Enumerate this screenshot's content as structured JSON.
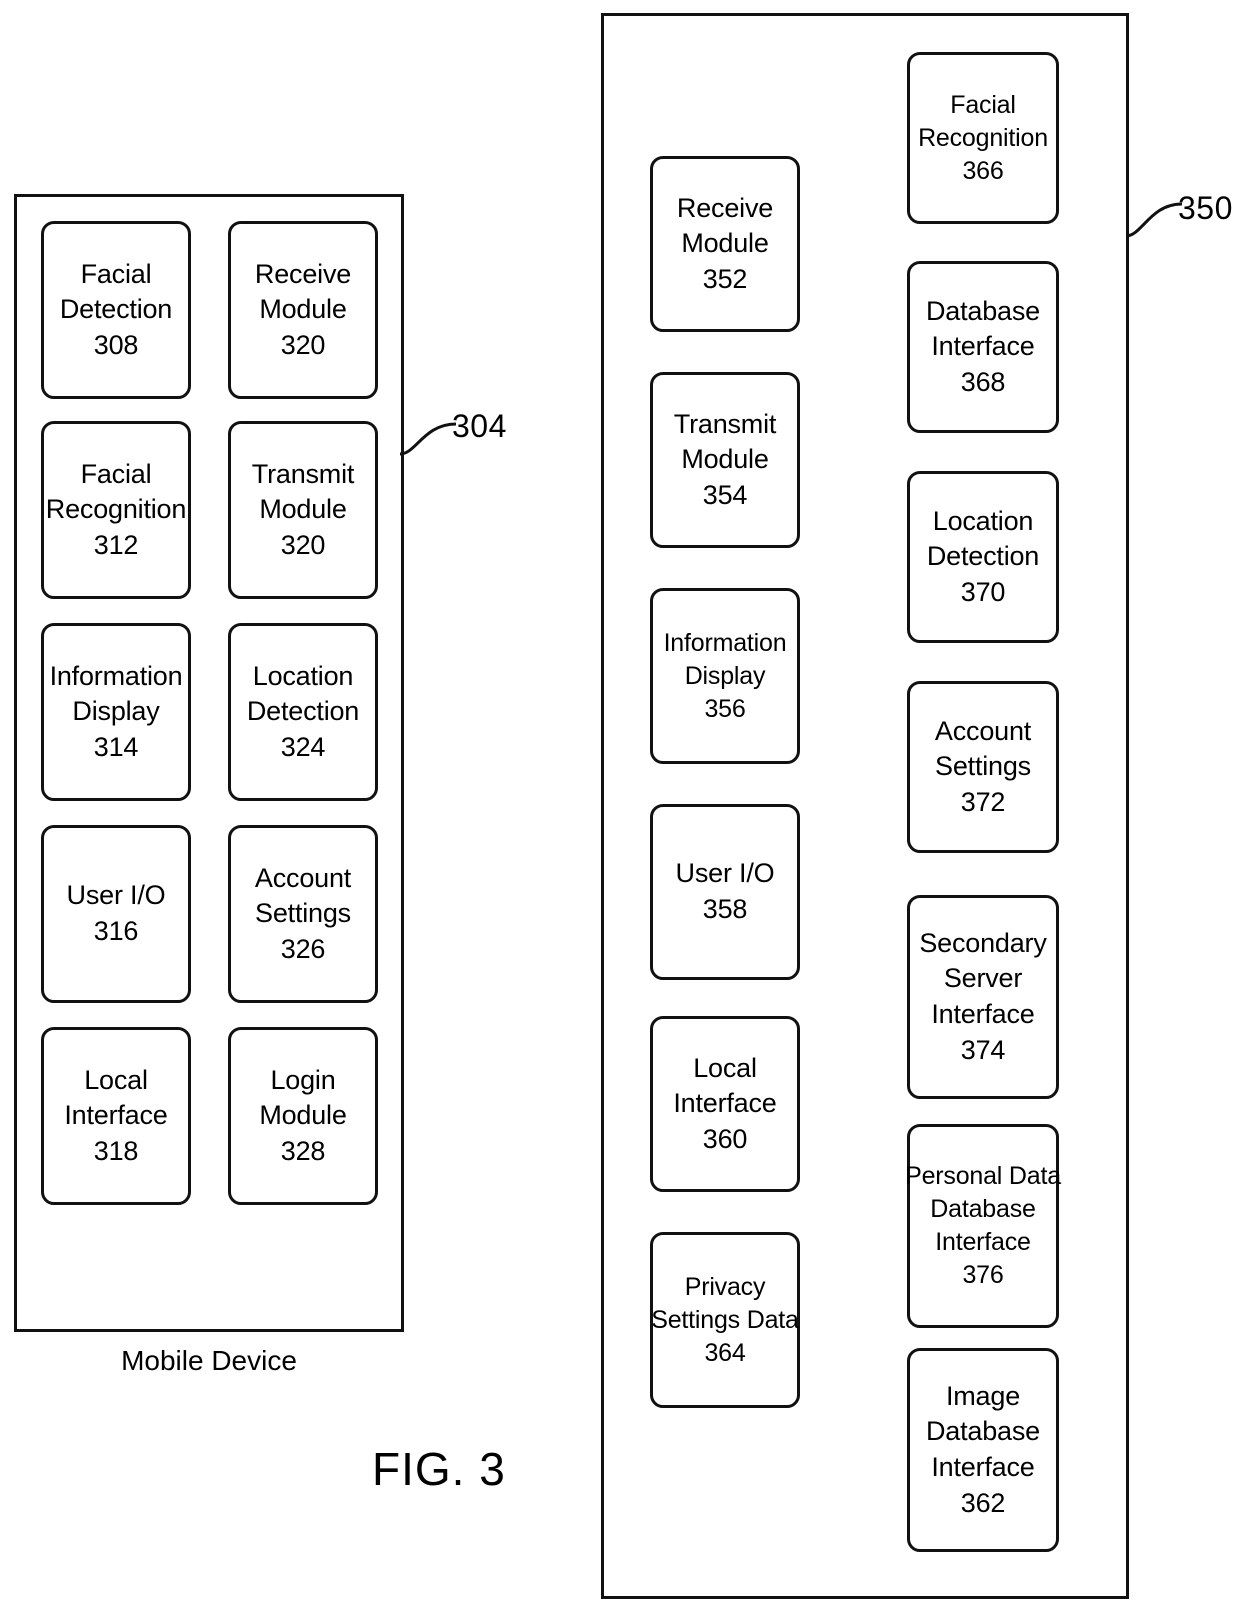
{
  "figure": {
    "label": "FIG. 3"
  },
  "mobile_device": {
    "caption": "Mobile Device",
    "callout": "304",
    "columns": [
      {
        "name": "left-column",
        "boxes": [
          {
            "lines": [
              "Facial",
              "Detection"
            ],
            "ref": "308"
          },
          {
            "lines": [
              "Facial",
              "Recognition"
            ],
            "ref": "312"
          },
          {
            "lines": [
              "Information",
              "Display"
            ],
            "ref": "314"
          },
          {
            "lines": [
              "User I/O"
            ],
            "ref": "316"
          },
          {
            "lines": [
              "Local",
              "Interface"
            ],
            "ref": "318"
          }
        ]
      },
      {
        "name": "right-column",
        "boxes": [
          {
            "lines": [
              "Receive",
              "Module"
            ],
            "ref": "320"
          },
          {
            "lines": [
              "Transmit",
              "Module"
            ],
            "ref": "320"
          },
          {
            "lines": [
              "Location",
              "Detection"
            ],
            "ref": "324"
          },
          {
            "lines": [
              "Account",
              "Settings"
            ],
            "ref": "326"
          },
          {
            "lines": [
              "Login",
              "Module"
            ],
            "ref": "328"
          }
        ]
      }
    ]
  },
  "server": {
    "callout": "350",
    "columns": [
      {
        "name": "left-column",
        "boxes": [
          {
            "lines": [
              "Receive",
              "Module"
            ],
            "ref": "352"
          },
          {
            "lines": [
              "Transmit",
              "Module"
            ],
            "ref": "354"
          },
          {
            "lines": [
              "Information",
              "Display"
            ],
            "ref": "356"
          },
          {
            "lines": [
              "User I/O"
            ],
            "ref": "358"
          },
          {
            "lines": [
              "Local",
              "Interface"
            ],
            "ref": "360"
          },
          {
            "lines": [
              "Privacy",
              "Settings Data"
            ],
            "ref": "364"
          }
        ]
      },
      {
        "name": "right-column",
        "boxes": [
          {
            "lines": [
              "Facial",
              "Recognition"
            ],
            "ref": "366"
          },
          {
            "lines": [
              "Database",
              "Interface"
            ],
            "ref": "368"
          },
          {
            "lines": [
              "Location",
              "Detection"
            ],
            "ref": "370"
          },
          {
            "lines": [
              "Account",
              "Settings"
            ],
            "ref": "372"
          },
          {
            "lines": [
              "Secondary",
              "Server",
              "Interface"
            ],
            "ref": "374"
          },
          {
            "lines": [
              "Personal Data",
              "Database",
              "Interface"
            ],
            "ref": "376"
          },
          {
            "lines": [
              "Image",
              "Database",
              "Interface"
            ],
            "ref": "362"
          }
        ]
      }
    ]
  },
  "colors": {
    "ink": "#111111",
    "paper": "#ffffff"
  }
}
